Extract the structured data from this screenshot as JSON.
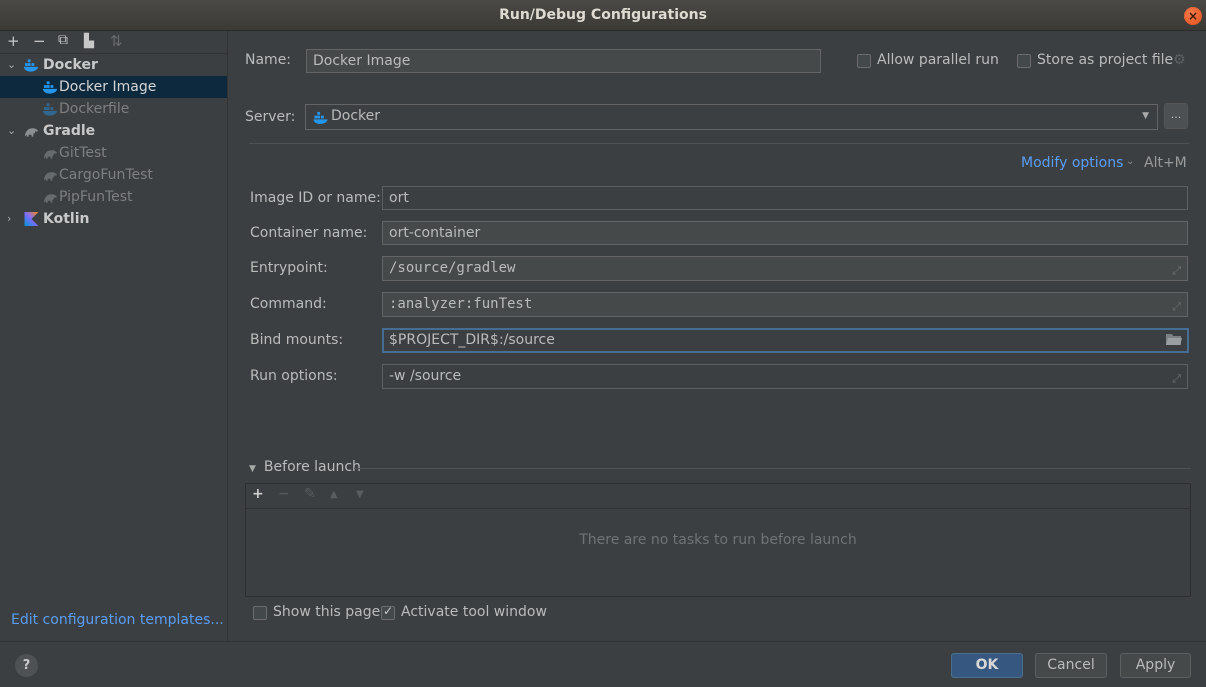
{
  "window": {
    "title": "Run/Debug Configurations"
  },
  "sidebar": {
    "toolbar": [
      {
        "icon": "add-icon",
        "glyph": "+"
      },
      {
        "icon": "remove-icon",
        "glyph": "−"
      },
      {
        "icon": "copy-icon",
        "glyph": "⧉"
      },
      {
        "icon": "new-folder-icon",
        "glyph": "▙"
      },
      {
        "icon": "sort-icon",
        "glyph": "⇅"
      }
    ],
    "tree": {
      "docker": {
        "label": "Docker",
        "expanded": true
      },
      "docker_image": {
        "label": "Docker Image"
      },
      "dockerfile": {
        "label": "Dockerfile"
      },
      "gradle": {
        "label": "Gradle",
        "expanded": true
      },
      "gittest": {
        "label": "GitTest"
      },
      "cargofuntest": {
        "label": "CargoFunTest"
      },
      "pipfuntest": {
        "label": "PipFunTest"
      },
      "kotlin": {
        "label": "Kotlin",
        "expanded": false
      }
    },
    "edit_templates_link": "Edit configuration templates..."
  },
  "form": {
    "name_label": "Name:",
    "name_value": "Docker Image",
    "allow_parallel_label": "Allow parallel run",
    "allow_parallel_checked": false,
    "store_project_label": "Store as project file",
    "store_project_checked": false,
    "server_label": "Server:",
    "server_value": "Docker",
    "more_button": "...",
    "modify_options": "Modify options",
    "modify_shortcut": "Alt+M",
    "fields": {
      "image": {
        "label": "Image ID or name:",
        "value": "ort"
      },
      "container": {
        "label": "Container name:",
        "value": "ort-container"
      },
      "entrypoint": {
        "label": "Entrypoint:",
        "value": "/source/gradlew"
      },
      "command": {
        "label": "Command:",
        "value": ":analyzer:funTest"
      },
      "bind_mounts": {
        "label": "Bind mounts:",
        "value": "$PROJECT_DIR$:/source"
      },
      "run_options": {
        "label": "Run options:",
        "value": "-w /source"
      }
    }
  },
  "before_launch": {
    "header": "Before launch",
    "empty_text": "There are no tasks to run before launch",
    "toolbar": [
      "+",
      "−",
      "✎",
      "▲",
      "▼"
    ],
    "show_page_label": "Show this page",
    "show_page_checked": false,
    "activate_label": "Activate tool window",
    "activate_checked": true
  },
  "footer": {
    "help": "?",
    "ok": "OK",
    "cancel": "Cancel",
    "apply": "Apply"
  },
  "colors": {
    "accent_link": "#589df6",
    "selection": "#0d293e",
    "ok_button": "#365880",
    "close_button": "#e95420"
  }
}
